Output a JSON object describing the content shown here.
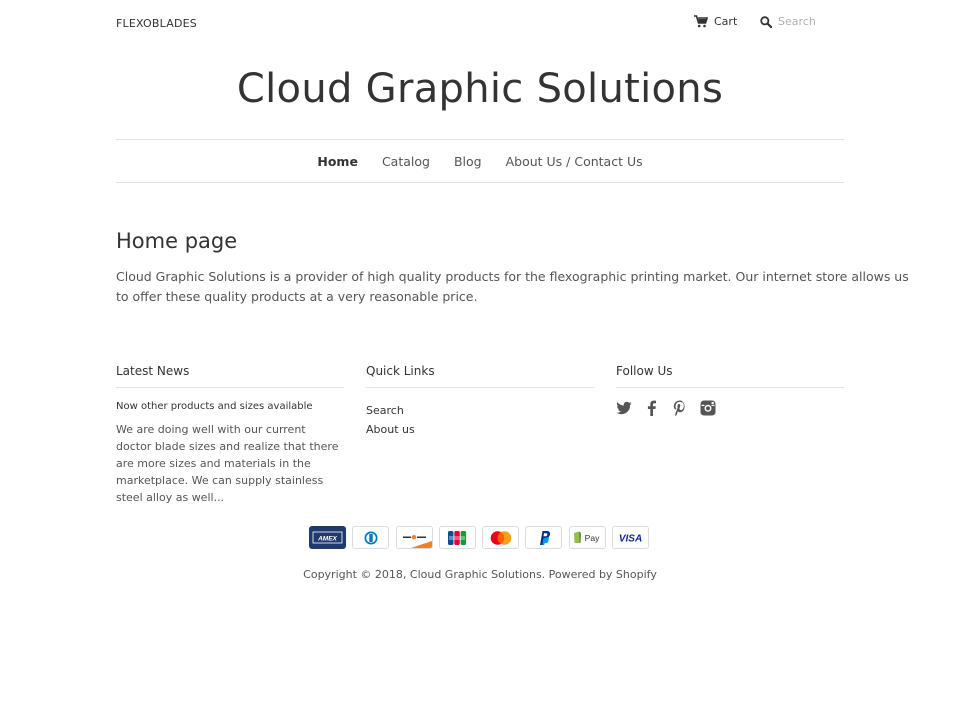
{
  "header": {
    "brand_link": "FLEXOBLADES",
    "cart_label": "Cart",
    "search_placeholder": "Search",
    "site_title": "Cloud Graphic Solutions"
  },
  "nav": {
    "items": [
      {
        "label": "Home",
        "active": true
      },
      {
        "label": "Catalog"
      },
      {
        "label": "Blog"
      },
      {
        "label": "About Us / Contact Us"
      }
    ]
  },
  "main": {
    "heading": "Home page",
    "body": "Cloud Graphic Solutions is a provider of high quality products for the flexographic printing market. Our internet store allows us to offer these quality products at a very reasonable price."
  },
  "footer": {
    "latest_news": {
      "heading": "Latest News",
      "article_title": "Now other products and sizes available",
      "article_excerpt": "We are doing well with our current doctor blade sizes and realize that there are more sizes and materials in the marketplace.  We can supply stainless steel alloy as well..."
    },
    "quick_links": {
      "heading": "Quick Links",
      "items": [
        "Search",
        "About us"
      ]
    },
    "follow_us": {
      "heading": "Follow Us",
      "icons": [
        "twitter-icon",
        "facebook-icon",
        "pinterest-icon",
        "instagram-icon"
      ]
    },
    "payment_icons": [
      "amex",
      "diners-club",
      "discover",
      "jcb",
      "mastercard",
      "paypal",
      "shopify-pay",
      "visa"
    ],
    "payment_labels": {
      "amex": "AMEX",
      "shopify_pay": "Pay",
      "visa": "VISA"
    },
    "copyright": "Copyright © 2018, Cloud Graphic Solutions. Powered by Shopify"
  },
  "colors": {
    "text": "#333333",
    "muted": "#555555",
    "divider": "#e2e2e2",
    "amex": "#1f3b6e",
    "mastercard_red": "#eb001b",
    "mastercard_orange": "#f79e1b",
    "paypal": "#003087",
    "shopify_pay": "#5a31f4",
    "visa": "#142688"
  }
}
